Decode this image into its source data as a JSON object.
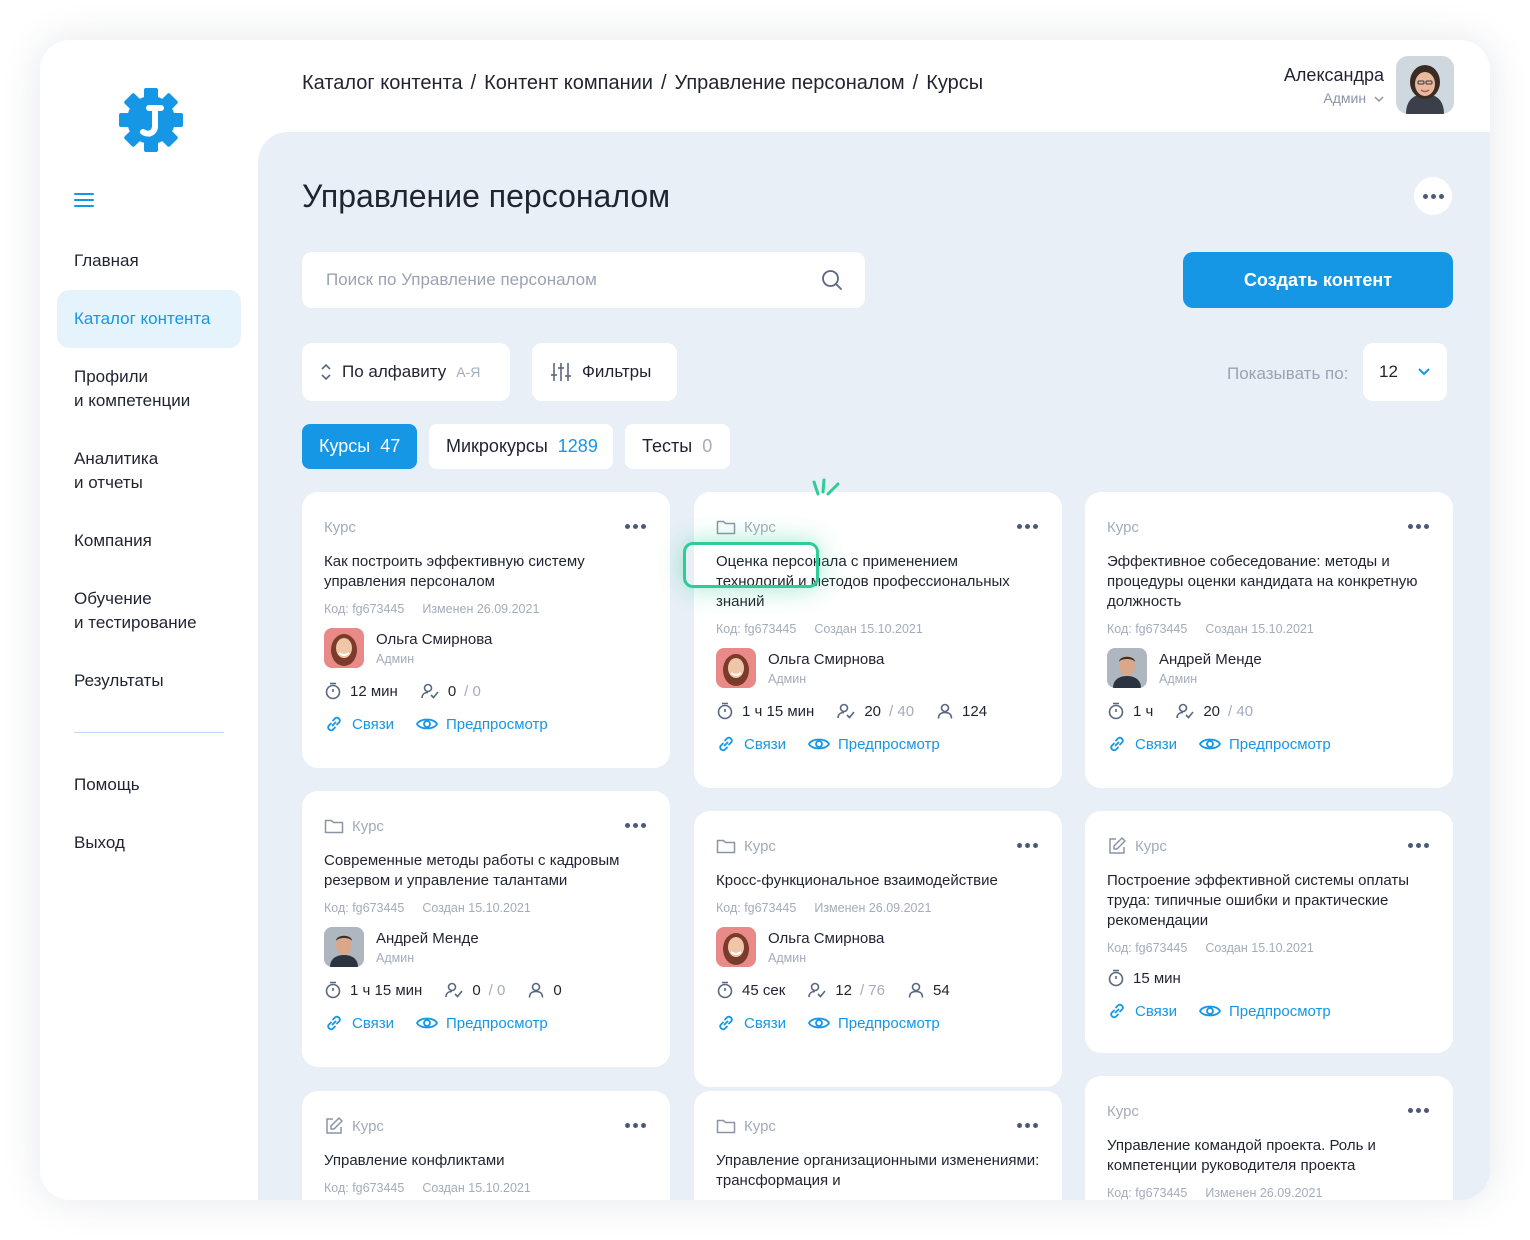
{
  "header": {
    "breadcrumb": [
      "Каталог контента",
      "Контент компании",
      "Управление персоналом",
      "Курсы"
    ],
    "user_name": "Александра",
    "user_role": "Админ"
  },
  "sidebar": {
    "items": [
      {
        "label1": "Главная",
        "label2": ""
      },
      {
        "label1": "Каталог контента",
        "label2": ""
      },
      {
        "label1": "Профили",
        "label2": "и компетенции"
      },
      {
        "label1": "Аналитика",
        "label2": "и отчеты"
      },
      {
        "label1": "Компания",
        "label2": ""
      },
      {
        "label1": "Обучение",
        "label2": "и тестирование"
      },
      {
        "label1": "Результаты",
        "label2": ""
      }
    ],
    "bottom_items": [
      "Помощь",
      "Выход"
    ]
  },
  "main": {
    "title": "Управление персоналом",
    "search_placeholder": "Поиск по Управление персоналом",
    "create_button": "Создать контент",
    "sort_label": "По алфавиту",
    "sort_order": "А-Я",
    "filters_label": "Фильтры",
    "show_label": "Показывать по:",
    "page_size": "12",
    "tabs": [
      {
        "label": "Курсы",
        "count": "47"
      },
      {
        "label": "Микрокурсы",
        "count": "1289"
      },
      {
        "label": "Тесты",
        "count": "0"
      }
    ]
  },
  "cards": [
    {
      "type": "Курс",
      "icon": "none",
      "title": "Как построить эффективную систему управления персоналом",
      "code": "Код: fg673445",
      "date": "Изменен 26.09.2021",
      "author": "Ольга Смирнова",
      "role": "Админ",
      "duration": "12 мин",
      "progress": "0",
      "progress_total": "/ 0",
      "participants": "",
      "links": "Связи",
      "preview": "Предпросмотр"
    },
    {
      "type": "Курс",
      "icon": "folder-icon",
      "title": "Оценка персонала с применением технологий и методов профессиональных знаний",
      "code": "Код: fg673445",
      "date": "Создан 15.10.2021",
      "author": "Ольга Смирнова",
      "role": "Админ",
      "duration": "1 ч 15 мин",
      "progress": "20",
      "progress_total": "/ 40",
      "participants": "124",
      "links": "Связи",
      "preview": "Предпросмотр"
    },
    {
      "type": "Курс",
      "icon": "none",
      "title": "Эффективное собеседование: методы и процедуры оценки кандидата на конкретную должность",
      "code": "Код: fg673445",
      "date": "Создан 15.10.2021",
      "author": "Андрей Менде",
      "role": "Админ",
      "duration": "1 ч",
      "progress": "20",
      "progress_total": "/ 40",
      "participants": "",
      "links": "Связи",
      "preview": "Предпросмотр"
    },
    {
      "type": "Курс",
      "icon": "folder-icon",
      "title": "Современные методы работы с кадровым резервом и управление талантами",
      "code": "Код: fg673445",
      "date": "Создан 15.10.2021",
      "author": "Андрей Менде",
      "role": "Админ",
      "duration": "1 ч 15 мин",
      "progress": "0",
      "progress_total": "/ 0",
      "participants": "0",
      "links": "Связи",
      "preview": "Предпросмотр"
    },
    {
      "type": "Курс",
      "icon": "folder-icon",
      "title": "Кросс-функциональное взаимодействие",
      "code": "Код: fg673445",
      "date": "Изменен 26.09.2021",
      "author": "Ольга Смирнова",
      "role": "Админ",
      "duration": "45 сек",
      "progress": "12",
      "progress_total": "/ 76",
      "participants": "54",
      "links": "Связи",
      "preview": "Предпросмотр"
    },
    {
      "type": "Курс",
      "icon": "edit-icon",
      "title": "Построение эффективной системы оплаты труда: типичные ошибки и практические рекомендации",
      "code": "Код: fg673445",
      "date": "Создан 15.10.2021",
      "author": "",
      "role": "",
      "duration": "15 мин",
      "progress": "",
      "progress_total": "",
      "participants": "",
      "links": "Связи",
      "preview": "Предпросмотр"
    },
    {
      "type": "Курс",
      "icon": "edit-icon",
      "title": "Управление конфликтами",
      "code": "Код: fg673445",
      "date": "Создан 15.10.2021"
    },
    {
      "type": "Курс",
      "icon": "folder-icon",
      "title": "Управление организационными изменениями: трансформация и",
      "code": "",
      "date": ""
    },
    {
      "type": "Курс",
      "icon": "none",
      "title": "Управление командой проекта. Роль и компетенции руководителя проекта",
      "code": "Код: fg673445",
      "date": "Изменен 26.09.2021"
    }
  ],
  "colors": {
    "accent": "#1597e5",
    "panel": "#e9eff7",
    "highlight": "#2fcc97"
  }
}
